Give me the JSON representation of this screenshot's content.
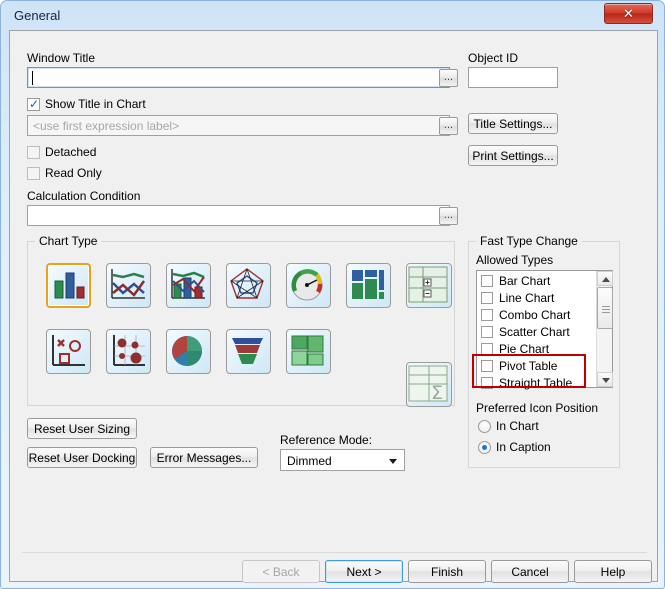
{
  "window": {
    "title": "General",
    "close_icon": "close-icon",
    "close_glyph": "✕"
  },
  "form": {
    "window_title_label": "Window Title",
    "window_title_value": "",
    "object_id_label": "Object ID",
    "object_id_value": "",
    "show_title_label": "Show Title in Chart",
    "show_title_checked": true,
    "title_expression_placeholder": "<use first expression label>",
    "title_expression_value": "",
    "detached_label": "Detached",
    "detached_checked": false,
    "read_only_label": "Read Only",
    "read_only_checked": false,
    "calculation_condition_label": "Calculation Condition",
    "calculation_condition_value": "",
    "browse_glyph": "...",
    "title_settings_label": "Title Settings...",
    "print_settings_label": "Print Settings..."
  },
  "chart_type": {
    "group_label": "Chart Type",
    "selected_index": 0,
    "items": [
      {
        "name": "bar-chart-icon",
        "label": "Bar Chart"
      },
      {
        "name": "line-chart-icon",
        "label": "Line Chart"
      },
      {
        "name": "combo-chart-icon",
        "label": "Combo Chart"
      },
      {
        "name": "radar-chart-icon",
        "label": "Radar Chart"
      },
      {
        "name": "gauge-chart-icon",
        "label": "Gauge Chart"
      },
      {
        "name": "block-chart-icon",
        "label": "Block Chart"
      },
      {
        "name": "pivot-table-icon",
        "label": "Pivot Table"
      },
      {
        "name": "scatter-chart-icon",
        "label": "Scatter Chart"
      },
      {
        "name": "grid-chart-icon",
        "label": "Grid Chart"
      },
      {
        "name": "pie-chart-icon",
        "label": "Pie Chart"
      },
      {
        "name": "funnel-chart-icon",
        "label": "Funnel Chart"
      },
      {
        "name": "mekko-chart-icon",
        "label": "Mekko Chart"
      },
      {
        "name": "straight-table-icon",
        "label": "Straight Table"
      }
    ]
  },
  "actions": {
    "reset_user_sizing": "Reset User Sizing",
    "reset_user_docking": "Reset User Docking",
    "error_messages": "Error Messages...",
    "reference_mode_label": "Reference Mode:",
    "reference_mode_value": "Dimmed",
    "reference_mode_options": [
      "Dimmed"
    ]
  },
  "fast_type_change": {
    "group_label": "Fast Type Change",
    "allowed_types_label": "Allowed Types",
    "allowed_types": [
      {
        "label": "Bar Chart",
        "checked": false
      },
      {
        "label": "Line Chart",
        "checked": false
      },
      {
        "label": "Combo Chart",
        "checked": false
      },
      {
        "label": "Scatter Chart",
        "checked": false
      },
      {
        "label": "Pie Chart",
        "checked": false
      },
      {
        "label": "Pivot Table",
        "checked": false
      },
      {
        "label": "Straight Table",
        "checked": false
      }
    ],
    "highlighted_items": [
      "Pivot Table",
      "Straight Table"
    ],
    "highlight_color": "#c00000",
    "preferred_icon_position_label": "Preferred Icon Position",
    "icon_position_options": [
      {
        "label": "In Chart",
        "selected": false
      },
      {
        "label": "In Caption",
        "selected": true
      }
    ]
  },
  "footer": {
    "back_label": "< Back",
    "back_disabled": true,
    "next_label": "Next >",
    "next_default": true,
    "finish_label": "Finish",
    "cancel_label": "Cancel",
    "help_label": "Help"
  }
}
